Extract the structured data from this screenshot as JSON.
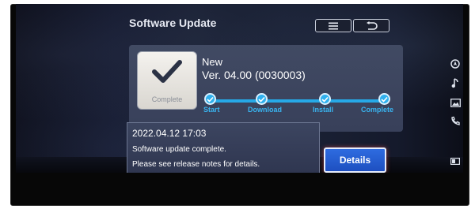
{
  "screen": {
    "title": "Software Update",
    "header_buttons": [
      {
        "icon": "list-menu-icon"
      },
      {
        "icon": "back-arrow-icon"
      }
    ]
  },
  "update_status": {
    "tile_label": "Complete",
    "tile_icon": "checkmark-icon",
    "version_new": "New",
    "version_number": "Ver. 04.00 (0030003)",
    "progress_steps": [
      {
        "label": "Start",
        "done": true
      },
      {
        "label": "Download",
        "done": true
      },
      {
        "label": "Install",
        "done": true
      },
      {
        "label": "Complete",
        "done": true
      }
    ],
    "progress_color": "#26a9e8"
  },
  "notice": {
    "date": "2022.04.12 17:03",
    "line1": "Software update complete.",
    "line2": "Please see release notes for details."
  },
  "details_button": {
    "label": "Details"
  },
  "side_icons": [
    "navigation-icon",
    "music-note-icon",
    "picture-icon",
    "phone-icon",
    "car-info-icon"
  ],
  "colors": {
    "accent_blue": "#2fb0ee",
    "button_blue": "#2e6ce0",
    "panel": "#414a63"
  }
}
